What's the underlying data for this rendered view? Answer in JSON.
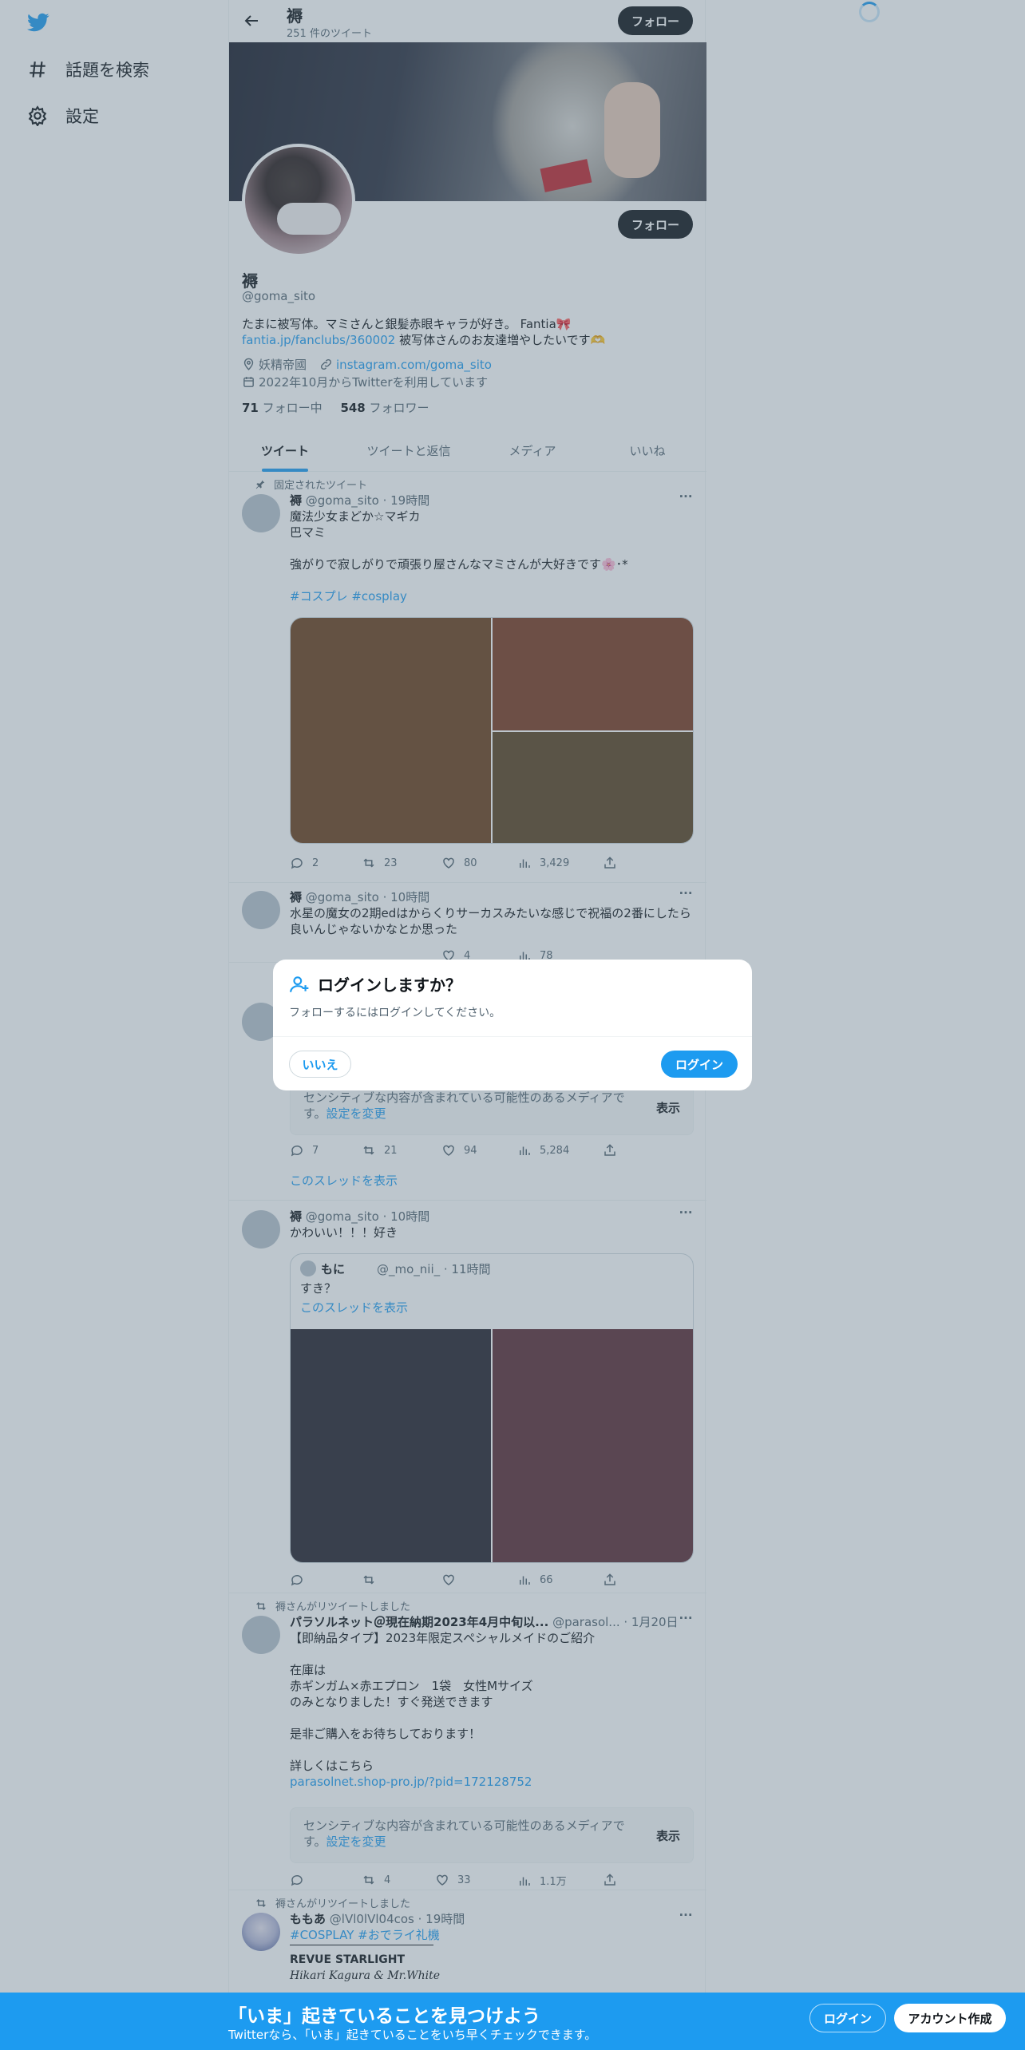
{
  "colors": {
    "accent": "#1d9bf0",
    "text": "#0f1419",
    "muted": "#536471"
  },
  "nav": {
    "explore": "話題を検索",
    "settings": "設定"
  },
  "topbar": {
    "name": "褥",
    "tweet_count": "251 件のツイート",
    "follow": "フォロー"
  },
  "profile": {
    "follow": "フォロー",
    "name": "褥",
    "handle": "@goma_sito",
    "bio_line1": "たまに被写体。マミさんと銀髪赤眼キャラが好き。 Fantia🎀",
    "bio_link": "fantia.jp/fanclubs/360002",
    "bio_line2_rest": " 被写体さんのお友達増やしたいです🫶",
    "location": "妖精帝國",
    "website": "instagram.com/goma_sito",
    "joined": "2022年10月からTwitterを利用しています",
    "following_count": "71",
    "following_label": " フォロー中",
    "followers_count": "548",
    "followers_label": " フォロワー"
  },
  "tabs": [
    "ツイート",
    "ツイートと返信",
    "メディア",
    "いいね"
  ],
  "tweets": {
    "t1": {
      "social": "固定されたツイート",
      "name": "褥",
      "meta": " @goma_sito · 19時間",
      "line1": "魔法少女まどか☆マギカ",
      "line2": "巴マミ",
      "line3": "強がりで寂しがりで頑張り屋さんなマミさんが大好きです🌸･*",
      "tags": "#コスプレ #cosplay",
      "reply": "2",
      "retweet": "23",
      "like": "80",
      "views": "3,429"
    },
    "t2": {
      "name": "褥",
      "meta": " @goma_sito · 10時間",
      "line1": "水星の魔女の2期edはからくりサーカスみたいな感じで祝福の2番にしたら",
      "line2": "良いんじゃないかなとか思った",
      "like": "4",
      "views": "78"
    },
    "t3": {
      "sensitive": "センシティブな内容が含まれている可能性のあるメディアで",
      "sensitive2": "す。",
      "settings_link": "設定を変更",
      "show": "表示",
      "reply": "7",
      "retweet": "21",
      "like": "94",
      "views": "5,284",
      "thread": "このスレッドを表示"
    },
    "t4": {
      "name": "褥",
      "meta": " @goma_sito · 10時間",
      "text": "かわいい！！！好き",
      "q_name": "もに",
      "q_meta": "@_mo_nii_ · 11時間",
      "q_text": "すき？",
      "q_thread": "このスレッドを表示",
      "views": "66"
    },
    "t5": {
      "social": "褥さんがリツイートしました",
      "name": "パラソルネット＠現在納期2023年4月中旬以...",
      "meta": " @parasol... · 1月20日",
      "l1": "【即納品タイプ】2023年限定スペシャルメイドのご紹介",
      "l2": "在庫は",
      "l3": "赤ギンガム×赤エプロン　1袋　女性Mサイズ",
      "l4": "のみとなりました！すぐ発送できます",
      "l5": "是非ご購入をお待ちしております！",
      "l6": "詳しくはこちら",
      "link": "parasolnet.shop-pro.jp/?pid=172128752",
      "sensitive": "センシティブな内容が含まれている可能性のあるメディアで",
      "sensitive2": "す。",
      "settings_link": "設定を変更",
      "show": "表示",
      "retweet": "4",
      "like": "33",
      "views": "1.1万"
    },
    "t6": {
      "social": "褥さんがリツイートしました",
      "name": "ももあ",
      "meta": " @lVl0lVl04cos · 19時間",
      "tags": "#COSPLAY #おでライ礼機",
      "l1": "REVUE STARLIGHT",
      "l2": "Hikari Kagura & Mr.White"
    }
  },
  "modal": {
    "title": "ログインしますか？",
    "subtitle": "フォローするにはログインしてください。",
    "no": "いいえ",
    "login": "ログイン"
  },
  "bottom_bar": {
    "title": "「いま」起きていることを見つけよう",
    "subtitle": "Twitterなら、「いま」起きていることをいち早くチェックできます。",
    "login": "ログイン",
    "signup": "アカウント作成"
  }
}
